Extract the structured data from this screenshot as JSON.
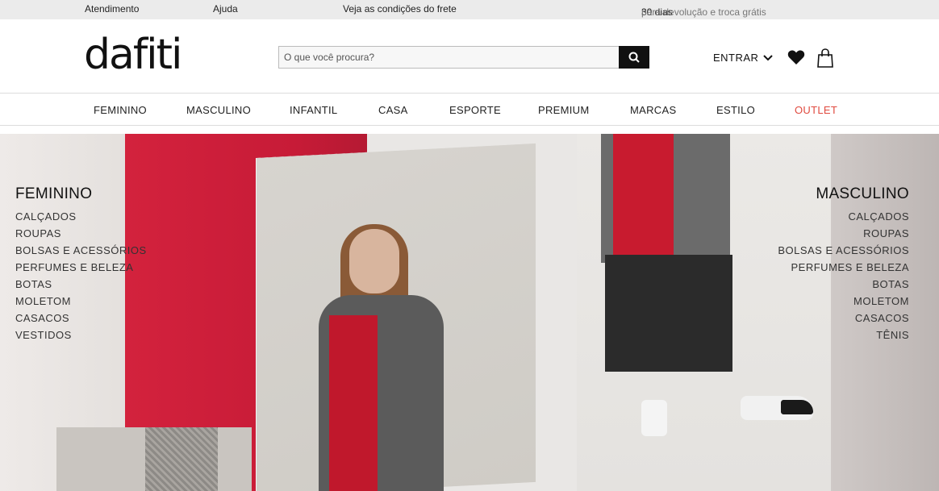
{
  "topbar": {
    "atendimento": "Atendimento",
    "ajuda": "Ajuda",
    "frete": "Veja as condições do frete",
    "devolucao_days": "30 dias",
    "devolucao_text": "para devolução e troca grátis"
  },
  "header": {
    "logo": "dafiti",
    "search_placeholder": "O que você procura?",
    "search_icon": "search-icon",
    "login_label": "ENTRAR",
    "wishlist_icon": "heart-icon",
    "cart_icon": "bag-icon"
  },
  "nav": {
    "items": [
      "FEMININO",
      "MASCULINO",
      "INFANTIL",
      "CASA",
      "ESPORTE",
      "PREMIUM",
      "MARCAS",
      "ESTILO",
      "OUTLET"
    ],
    "outlet_color": "#e04a3f"
  },
  "hero": {
    "left": {
      "title": "FEMININO",
      "links": [
        "CALÇADOS",
        "ROUPAS",
        "BOLSAS E ACESSÓRIOS",
        "PERFUMES E BELEZA",
        "BOTAS",
        "MOLETOM",
        "CASACOS",
        "VESTIDOS"
      ]
    },
    "right": {
      "title": "MASCULINO",
      "links": [
        "CALÇADOS",
        "ROUPAS",
        "BOLSAS E ACESSÓRIOS",
        "PERFUMES E BELEZA",
        "BOTAS",
        "MOLETOM",
        "CASACOS",
        "TÊNIS"
      ]
    }
  }
}
